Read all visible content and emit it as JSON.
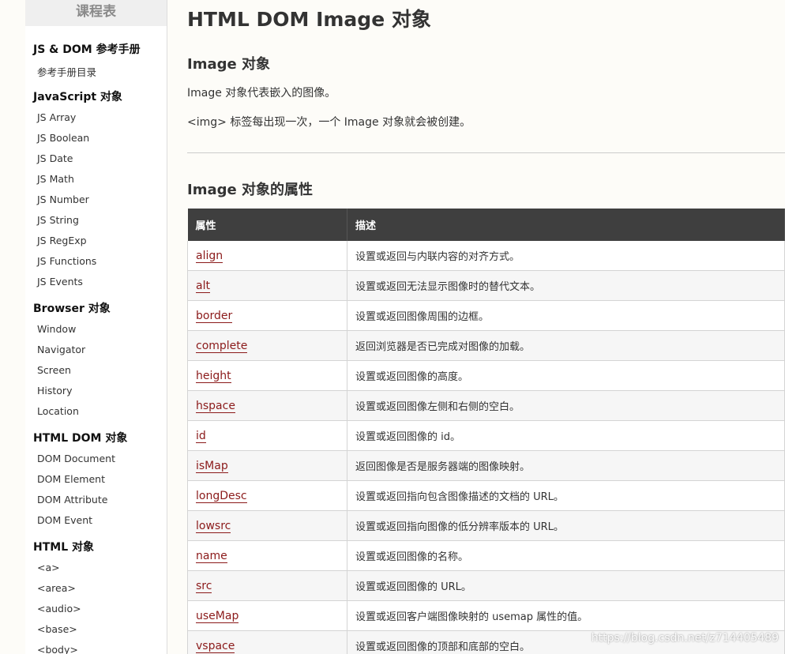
{
  "sidebar": {
    "header": "课程表",
    "groups": [
      {
        "title": "JS & DOM 参考手册",
        "items": [
          "参考手册目录"
        ]
      },
      {
        "title": "JavaScript 对象",
        "items": [
          "JS Array",
          "JS Boolean",
          "JS Date",
          "JS Math",
          "JS Number",
          "JS String",
          "JS RegExp",
          "JS Functions",
          "JS Events"
        ]
      },
      {
        "title": "Browser 对象",
        "items": [
          "Window",
          "Navigator",
          "Screen",
          "History",
          "Location"
        ]
      },
      {
        "title": "HTML DOM 对象",
        "items": [
          "DOM Document",
          "DOM Element",
          "DOM Attribute",
          "DOM Event"
        ]
      },
      {
        "title": "HTML 对象",
        "items": [
          "<a>",
          "<area>",
          "<audio>",
          "<base>",
          "<body>"
        ]
      }
    ]
  },
  "main": {
    "title": "HTML DOM Image 对象",
    "intro": {
      "heading": "Image 对象",
      "paragraphs": [
        "Image 对象代表嵌入的图像。",
        "<img> 标签每出现一次，一个 Image 对象就会被创建。"
      ]
    },
    "properties": {
      "heading": "Image 对象的属性",
      "columns": [
        "属性",
        "描述"
      ],
      "rows": [
        {
          "name": "align",
          "desc": "设置或返回与内联内容的对齐方式。"
        },
        {
          "name": "alt",
          "desc": "设置或返回无法显示图像时的替代文本。"
        },
        {
          "name": "border",
          "desc": "设置或返回图像周围的边框。"
        },
        {
          "name": "complete",
          "desc": "返回浏览器是否已完成对图像的加载。"
        },
        {
          "name": "height",
          "desc": "设置或返回图像的高度。"
        },
        {
          "name": "hspace",
          "desc": "设置或返回图像左侧和右侧的空白。"
        },
        {
          "name": "id",
          "desc": "设置或返回图像的 id。"
        },
        {
          "name": "isMap",
          "desc": "返回图像是否是服务器端的图像映射。"
        },
        {
          "name": "longDesc",
          "desc": "设置或返回指向包含图像描述的文档的 URL。"
        },
        {
          "name": "lowsrc",
          "desc": "设置或返回指向图像的低分辨率版本的 URL。"
        },
        {
          "name": "name",
          "desc": "设置或返回图像的名称。"
        },
        {
          "name": "src",
          "desc": "设置或返回图像的 URL。"
        },
        {
          "name": "useMap",
          "desc": "设置或返回客户端图像映射的 usemap 属性的值。"
        },
        {
          "name": "vspace",
          "desc": "设置或返回图像的顶部和底部的空白。"
        }
      ]
    }
  },
  "watermark": "https://blog.csdn.net/z714405489",
  "colors": {
    "link": "#8b1a1a",
    "table_header_bg": "#3f3f3f",
    "sidebar_header_bg": "#efefef"
  }
}
